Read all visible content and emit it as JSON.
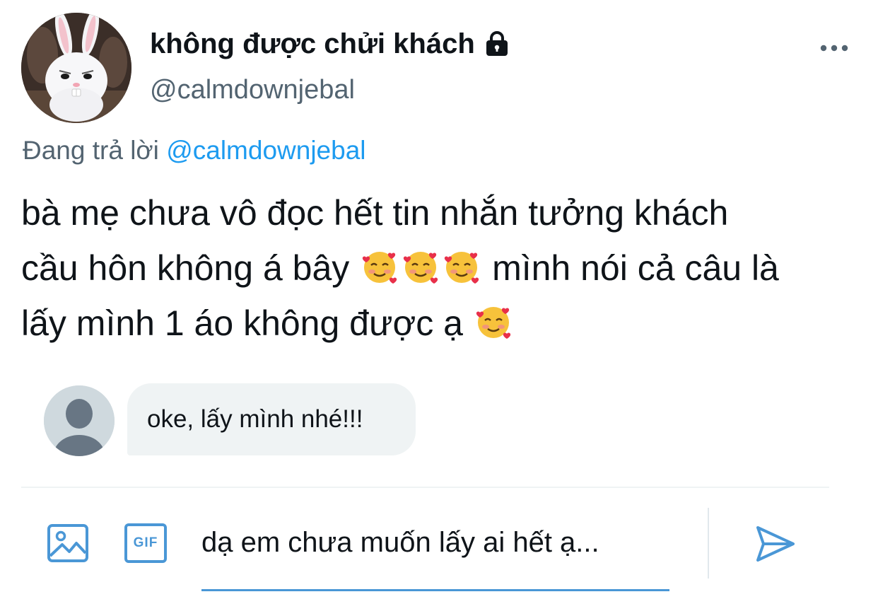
{
  "author": {
    "display_name": "không được chửi khách",
    "handle": "@calmdownjebal",
    "protected": true,
    "avatar_icon": "snowball-bunny-avatar"
  },
  "header": {
    "more_icon": "more-horizontal-icon"
  },
  "replying_to": {
    "prefix": "Đang trả lời",
    "mention": "@calmdownjebal"
  },
  "tweet": {
    "line1": "bà mẹ chưa vô đọc hết tin nhắn tưởng khách",
    "line2_a": "cầu hôn không á bây",
    "line2_b": "mình nói cả câu là",
    "line3": "lấy mình 1 áo không được ạ",
    "emoji_name": "smiling-face-with-hearts-emoji"
  },
  "reply": {
    "text": "oke, lấy mình nhé!!!",
    "avatar_icon": "default-user-avatar"
  },
  "composer": {
    "value": "dạ em chưa muốn lấy ai hết ạ...",
    "image_icon": "image-icon",
    "gif_label": "GIF",
    "send_icon": "send-icon"
  },
  "colors": {
    "accent": "#1d9bf0",
    "secondary_text": "#536471",
    "bubble_bg": "#eff3f4",
    "icon_blue": "#4a97d6"
  }
}
